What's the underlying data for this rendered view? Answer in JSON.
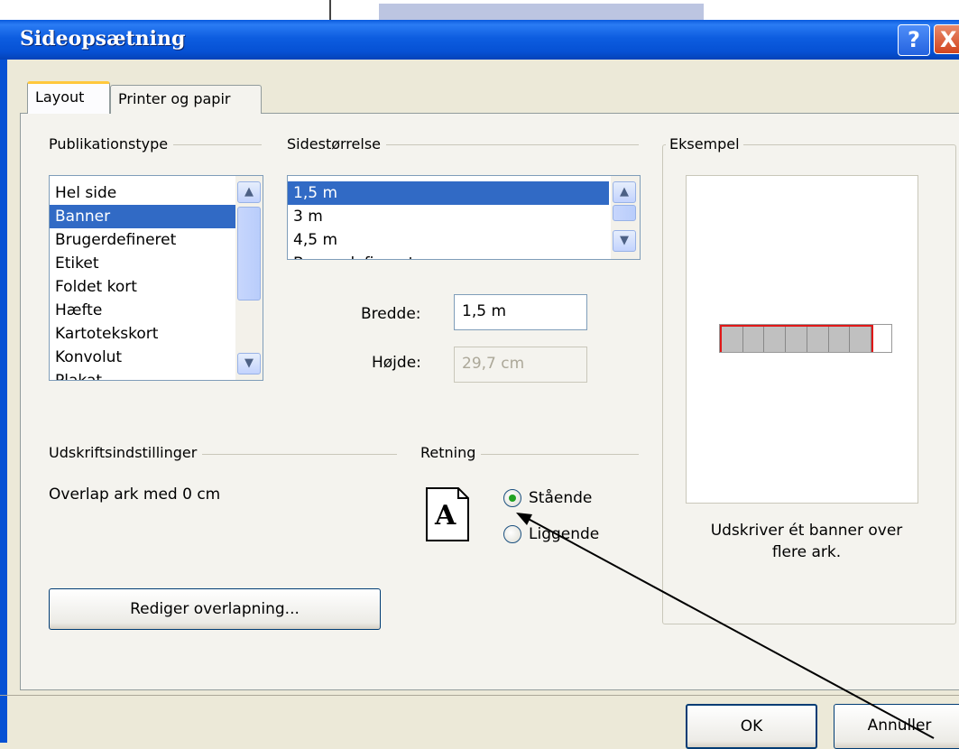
{
  "dialog": {
    "title": "Sideopsætning",
    "help_glyph": "?",
    "close_glyph": "X"
  },
  "tabs": [
    {
      "label": "Layout",
      "active": true
    },
    {
      "label": "Printer og papir",
      "active": false
    }
  ],
  "publication_type": {
    "label": "Publikationstype",
    "items": [
      "Hel side",
      "Banner",
      "Brugerdefineret",
      "Etiket",
      "Foldet kort",
      "Hæfte",
      "Kartotekskort",
      "Konvolut",
      "Plakat"
    ],
    "selected": "Banner"
  },
  "page_size": {
    "label": "Sidestørrelse",
    "items": [
      "1,5 m",
      "3 m",
      "4,5 m",
      "Brugerdefineret"
    ],
    "selected": "1,5 m"
  },
  "width_field": {
    "label": "Bredde:",
    "value": "1,5 m"
  },
  "height_field": {
    "label": "Højde:",
    "value": "29,7 cm",
    "disabled": true
  },
  "print_settings": {
    "label": "Udskriftsindstillinger",
    "overlap_text": "Overlap ark med 0 cm",
    "edit_overlap_button": "Rediger overlapning..."
  },
  "orientation": {
    "label": "Retning",
    "icon_letter": "A",
    "options": [
      {
        "label": "Stående",
        "checked": true
      },
      {
        "label": "Liggende",
        "checked": false
      }
    ]
  },
  "example": {
    "label": "Eksempel",
    "caption_line1": "Udskriver ét banner over",
    "caption_line2": "flere ark.",
    "sheets": 7
  },
  "buttons": {
    "ok": "OK",
    "cancel": "Annuller"
  },
  "colors": {
    "titlebar": "#0651d4",
    "selection": "#316ac5",
    "banner_outline": "#e01818"
  }
}
